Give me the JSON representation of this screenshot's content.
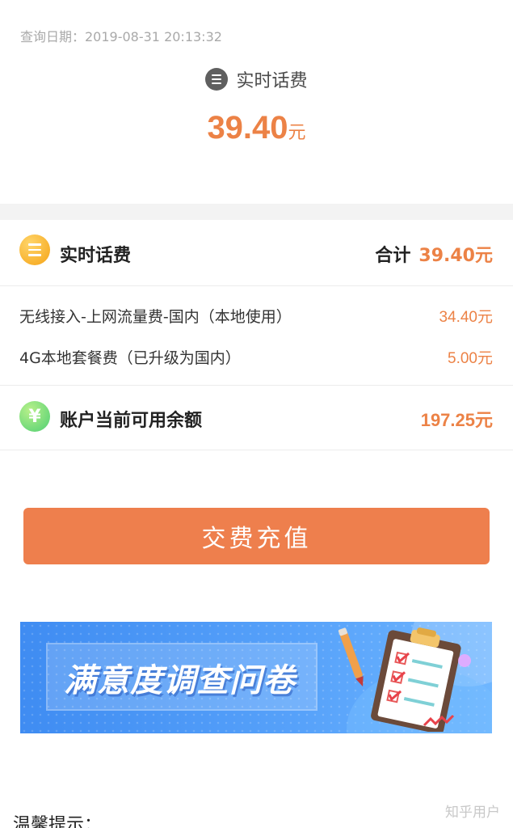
{
  "header": {
    "query_date": "查询日期：2019-08-31 20:13:32"
  },
  "hero": {
    "icon": "list-icon",
    "label": "实时话费",
    "amount": "39.40",
    "unit": "元"
  },
  "realtime_section": {
    "icon": "list-icon",
    "title": "实时话费",
    "total_label": "合计",
    "total_amount": "39.40元",
    "items": [
      {
        "name": "无线接入-上网流量费-国内（本地使用）",
        "amount": "34.40元"
      },
      {
        "name": "4G本地套餐费（已升级为国内）",
        "amount": "5.00元"
      }
    ]
  },
  "balance": {
    "icon": "yen-icon",
    "icon_glyph": "¥",
    "title": "账户当前可用余额",
    "amount": "197.25元"
  },
  "pay_button": {
    "label": "交费充值"
  },
  "banner": {
    "title": "满意度调查问卷",
    "icon": "clipboard-checklist-icon"
  },
  "tips": {
    "title": "温馨提示："
  },
  "watermark": "知乎用户",
  "colors": {
    "accent": "#ec8246",
    "button": "#ee7f4d",
    "banner_blue": "#4a96f6"
  }
}
